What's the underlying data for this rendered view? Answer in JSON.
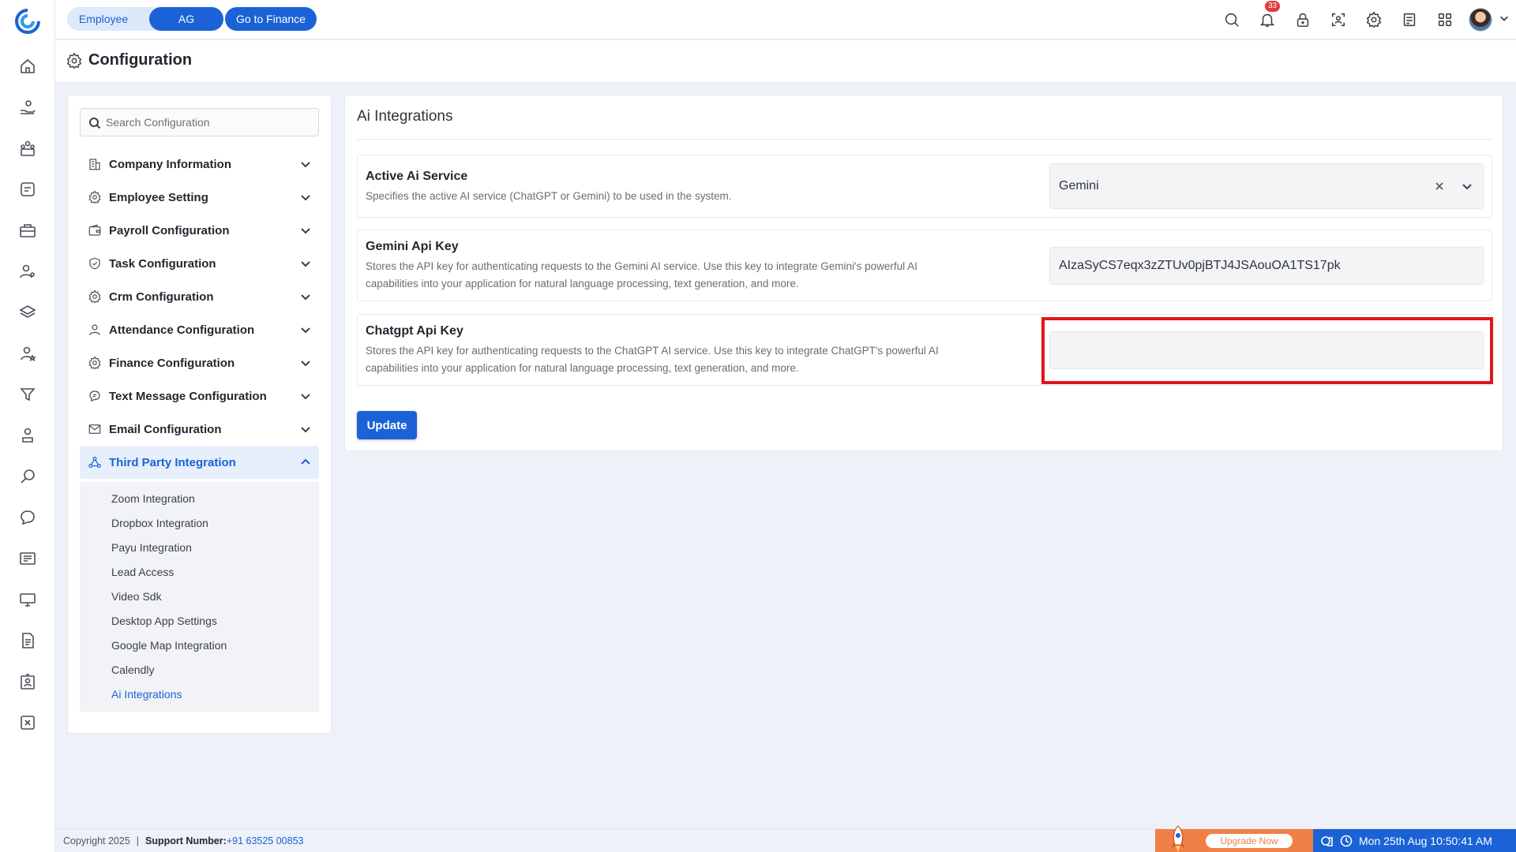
{
  "topbar": {
    "toggle_left": "Employee",
    "toggle_right": "AG",
    "finance_button": "Go to Finance",
    "notification_count": "33"
  },
  "page": {
    "title": "Configuration"
  },
  "config_menu": {
    "search_placeholder": "Search Configuration",
    "items": [
      {
        "label": "Company Information",
        "icon": "building-icon"
      },
      {
        "label": "Employee Setting",
        "icon": "gear-icon"
      },
      {
        "label": "Payroll Configuration",
        "icon": "wallet-icon"
      },
      {
        "label": "Task Configuration",
        "icon": "shield-check-icon"
      },
      {
        "label": "Crm Configuration",
        "icon": "gear-icon"
      },
      {
        "label": "Attendance Configuration",
        "icon": "user-icon"
      },
      {
        "label": "Finance Configuration",
        "icon": "gear-icon"
      },
      {
        "label": "Text Message Configuration",
        "icon": "chat-icon"
      },
      {
        "label": "Email Configuration",
        "icon": "mail-icon"
      },
      {
        "label": "Third Party Integration",
        "icon": "network-icon"
      }
    ],
    "sub_items": [
      "Zoom Integration",
      "Dropbox Integration",
      "Payu Integration",
      "Lead Access",
      "Video Sdk",
      "Desktop App Settings",
      "Google Map Integration",
      "Calendly",
      "Ai Integrations"
    ]
  },
  "content": {
    "title": "Ai Integrations",
    "active_service": {
      "label": "Active Ai Service",
      "description": "Specifies the active AI service (ChatGPT or Gemini) to be used in the system.",
      "value": "Gemini"
    },
    "gemini_key": {
      "label": "Gemini Api Key",
      "description_line1": "Stores the API key for authenticating requests to the Gemini AI service. Use this key to integrate Gemini's powerful AI",
      "description_line2": "capabilities into your application for natural language processing, text generation, and more.",
      "value": "AIzaSyCS7eqx3zZTUv0pjBTJ4JSAouOA1TS17pk"
    },
    "chatgpt_key": {
      "label": "Chatgpt Api Key",
      "description_line1": "Stores the API key for authenticating requests to the ChatGPT AI service. Use this key to integrate ChatGPT's powerful AI",
      "description_line2": "capabilities into your application for natural language processing, text generation, and more.",
      "value": ""
    },
    "update_button": "Update"
  },
  "footer": {
    "copyright": "Copyright 2025",
    "separator": "|",
    "support_label": "Support Number:",
    "support_phone": "+91 63525 00853",
    "upgrade": "Upgrade Now",
    "datetime": "Mon 25th Aug 10:50:41 AM"
  },
  "colors": {
    "accent": "#1a62d6",
    "highlight": "#e0161c",
    "upgrade": "#f08046"
  }
}
